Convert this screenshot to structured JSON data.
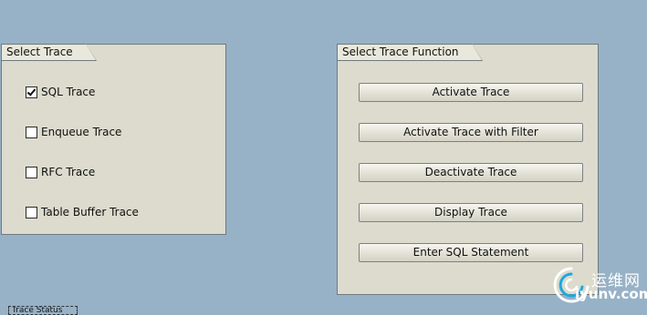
{
  "select_trace": {
    "title": "Select Trace",
    "options": [
      {
        "label": "SQL Trace",
        "checked": true
      },
      {
        "label": "Enqueue Trace",
        "checked": false
      },
      {
        "label": "RFC Trace",
        "checked": false
      },
      {
        "label": "Table Buffer Trace",
        "checked": false
      }
    ]
  },
  "trace_function": {
    "title": "Select Trace Function",
    "buttons": [
      "Activate Trace",
      "Activate Trace with Filter",
      "Deactivate Trace",
      "Display Trace",
      "Enter SQL Statement"
    ]
  },
  "status": {
    "label": "Trace Status"
  },
  "watermark": {
    "cn": "运维网",
    "en": "iyunv.com"
  },
  "colors": {
    "background": "#97b2c7",
    "panel": "#dcdbcd",
    "logo_accent": "#1fa8e0"
  }
}
